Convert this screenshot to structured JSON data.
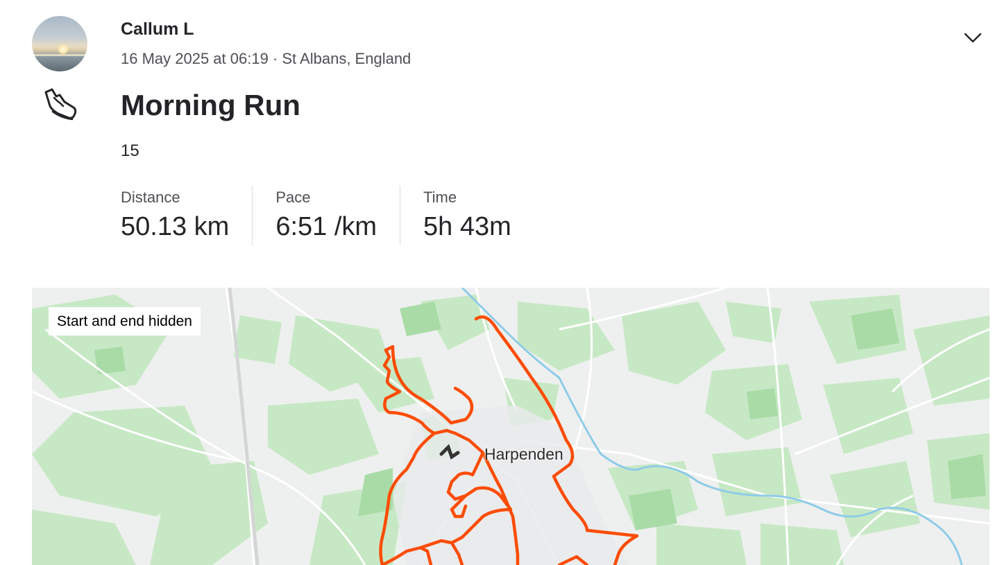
{
  "athlete": {
    "name": "Callum L"
  },
  "activity": {
    "datetime_location": "16 May 2025 at 06:19 · St Albans, England",
    "sport_icon": "running-shoe-icon",
    "title": "Morning Run",
    "description": "15",
    "stats": [
      {
        "label": "Distance",
        "value": "50.13 km"
      },
      {
        "label": "Pace",
        "value": "6:51 /km"
      },
      {
        "label": "Time",
        "value": "5h 43m"
      }
    ]
  },
  "menu_icon": "chevron-down-icon",
  "map": {
    "privacy_label": "Start and end hidden",
    "town_label": "Harpenden",
    "route_color": "#fc4c02",
    "land_color": "#c7e8c4",
    "water_color": "#8fcbe8"
  }
}
